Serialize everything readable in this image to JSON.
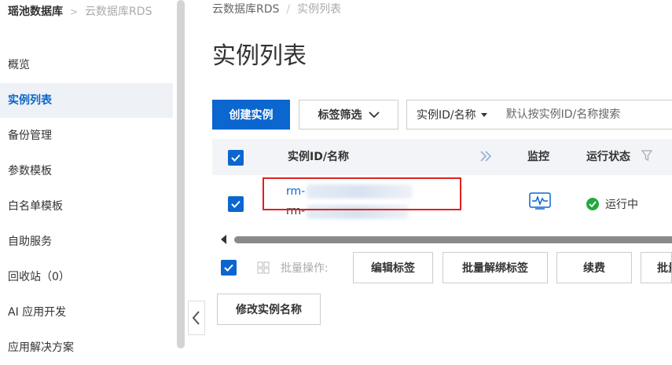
{
  "sidebar": {
    "title": "瑶池数据库",
    "subtitle": "云数据库RDS",
    "items": [
      {
        "label": "概览"
      },
      {
        "label": "实例列表"
      },
      {
        "label": "备份管理"
      },
      {
        "label": "参数模板"
      },
      {
        "label": "白名单模板"
      },
      {
        "label": "自助服务"
      },
      {
        "label": "回收站（0）"
      },
      {
        "label": "AI 应用开发"
      },
      {
        "label": "应用解决方案"
      }
    ]
  },
  "breadcrumb": {
    "root": "云数据库RDS",
    "current": "实例列表"
  },
  "page": {
    "title": "实例列表"
  },
  "toolbar": {
    "create_label": "创建实例",
    "filter_label": "标签筛选",
    "search_field": "实例ID/名称",
    "search_placeholder": "默认按实例ID/名称搜索"
  },
  "table": {
    "columns": {
      "id_name": "实例ID/名称",
      "monitor": "监控",
      "status": "运行状态"
    },
    "rows": [
      {
        "id_prefix": "rm-",
        "name_prefix": "rm-",
        "status": "运行中",
        "checked": true
      }
    ]
  },
  "bulk": {
    "label": "批量操作:",
    "buttons": [
      "编辑标签",
      "批量解绑标签",
      "续费",
      "批量"
    ],
    "rename_label": "修改实例名称"
  },
  "colors": {
    "primary": "#0b66d0",
    "success": "#1faa3c",
    "highlight": "#e02020"
  }
}
